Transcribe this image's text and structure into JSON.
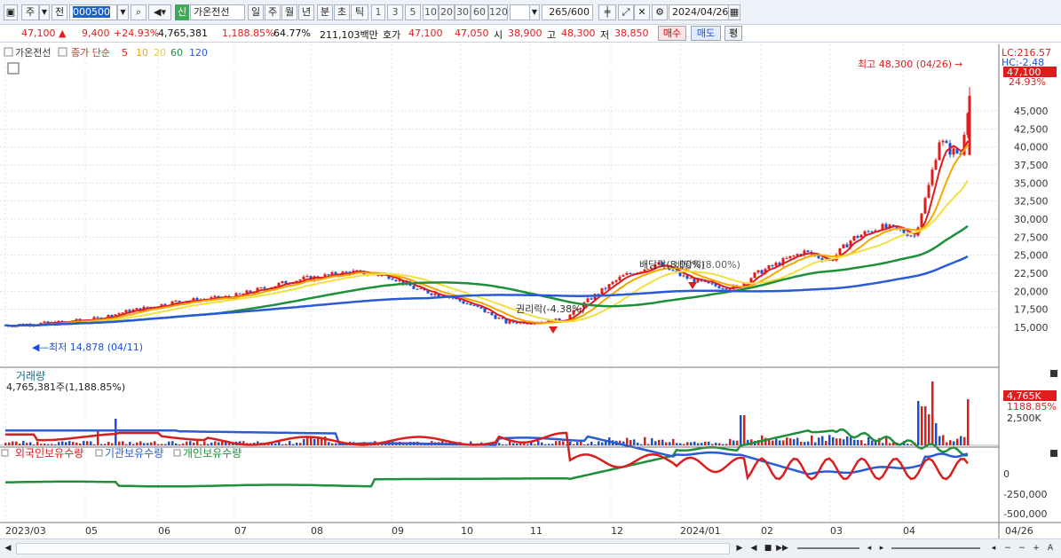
{
  "toolbar": {
    "type_label": "주",
    "prev_label": "전",
    "code": "000500",
    "market_badge": "신",
    "stock_name": "가온전선",
    "periods": [
      "일",
      "주",
      "월",
      "년",
      "분",
      "초",
      "틱"
    ],
    "active_period": "일",
    "intervals": [
      "1",
      "3",
      "5",
      "10",
      "20",
      "30",
      "60",
      "120"
    ],
    "count": "265",
    "count_total": "/600",
    "date": "2024/04/26"
  },
  "quote": {
    "price": "47,100",
    "change": "9,400",
    "change_pct": "+24.93%",
    "volume": "4,765,381",
    "volume_pct": "1,188.85%",
    "turnover": "64.77%",
    "amount": "211,103백만",
    "bid_label": "호가",
    "ask_price": "47,100",
    "bid_price": "47,050",
    "open_label": "시",
    "open": "38,900",
    "high_label": "고",
    "high": "48,300",
    "low_label": "저",
    "low": "38,850",
    "buy_label": "매수",
    "sell_label": "매도",
    "eval_label": "평"
  },
  "price_panel": {
    "legend_name": "가온전선",
    "legend_ma": "종가 단순",
    "ma_periods": [
      {
        "label": "5",
        "color": "#e01d1d"
      },
      {
        "label": "10",
        "color": "#f7a600"
      },
      {
        "label": "20",
        "color": "#f2e03c"
      },
      {
        "label": "60",
        "color": "#1e8f3a"
      },
      {
        "label": "120",
        "color": "#2a5bd6"
      }
    ],
    "lc_label": "LC:216.57",
    "hc_label": "HC:-2.48",
    "price_tag": "47,100",
    "pct_tag": "24.93%",
    "high_note": "최고 48,300 (04/26)",
    "low_note": "최저 14,878 (04/11)",
    "event_1": "배당락(8.00%)",
    "event_2": "권리락(-4.38%)",
    "y_ticks": [
      "45,000",
      "42,500",
      "40,000",
      "37,500",
      "35,000",
      "32,500",
      "30,000",
      "27,500",
      "25,000",
      "22,500",
      "20,000",
      "17,500",
      "15,000"
    ]
  },
  "volume_panel": {
    "title": "거래량",
    "subtitle": "4,765,381주(1,188.85%)",
    "tag": "4,765K",
    "tag_pct": "1188.85%",
    "y_tick": "2,500K"
  },
  "holding_panel": {
    "legends": [
      {
        "label": "외국인보유수량",
        "color": "#d81e1e"
      },
      {
        "label": "기관보유수량",
        "color": "#2a5bd6"
      },
      {
        "label": "개인보유수량",
        "color": "#1e8f3a"
      }
    ],
    "y_ticks": [
      "0",
      "-250,000",
      "-500,000"
    ]
  },
  "x_axis": {
    "labels": [
      "2023/03",
      "05",
      "06",
      "07",
      "08",
      "09",
      "10",
      "11",
      "12",
      "2024/01",
      "02",
      "03",
      "04"
    ],
    "end_label": "04/26"
  },
  "colors": {
    "up": "#e01d1d",
    "down": "#1c4ed8",
    "background": "#ffffff",
    "grid": "#e2e2e2"
  }
}
